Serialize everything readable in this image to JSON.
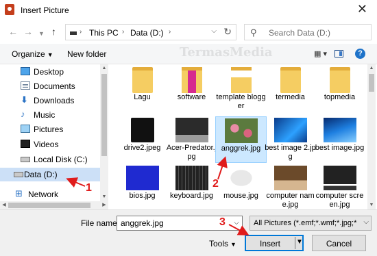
{
  "window": {
    "title": "Insert Picture"
  },
  "address": {
    "crumbs": [
      "This PC",
      "Data (D:)"
    ]
  },
  "search": {
    "placeholder": "Search Data (D:)"
  },
  "toolbar": {
    "organize": "Organize",
    "new_folder": "New folder"
  },
  "watermark": "TermasMedia",
  "nav": {
    "items": [
      {
        "label": "Desktop",
        "icon": "desktop-icon"
      },
      {
        "label": "Documents",
        "icon": "documents-icon"
      },
      {
        "label": "Downloads",
        "icon": "downloads-icon"
      },
      {
        "label": "Music",
        "icon": "music-icon"
      },
      {
        "label": "Pictures",
        "icon": "pictures-icon"
      },
      {
        "label": "Videos",
        "icon": "videos-icon"
      },
      {
        "label": "Local Disk (C:)",
        "icon": "disk-icon"
      },
      {
        "label": "Data (D:)",
        "icon": "disk-icon",
        "selected": true
      },
      {
        "label": "Network",
        "icon": "network-icon"
      }
    ]
  },
  "files": [
    {
      "label": "Lagu",
      "kind": "folder"
    },
    {
      "label": "software",
      "kind": "folder-pink"
    },
    {
      "label": "template blogger",
      "kind": "folder-paper"
    },
    {
      "label": "termedia",
      "kind": "folder"
    },
    {
      "label": "topmedia",
      "kind": "folder"
    },
    {
      "label": "drive2.jpeg",
      "kind": "floppy"
    },
    {
      "label": "Acer-Predator.jpg",
      "kind": "laptop"
    },
    {
      "label": "anggrek.jpg",
      "kind": "flower",
      "selected": true
    },
    {
      "label": "best image 2.jpg",
      "kind": "blue"
    },
    {
      "label": "best image.jpg",
      "kind": "blue2"
    },
    {
      "label": "bios.jpg",
      "kind": "bios"
    },
    {
      "label": "keyboard.jpg",
      "kind": "keyboard"
    },
    {
      "label": "mouse.jpg",
      "kind": "mouse"
    },
    {
      "label": "computer name.jpg",
      "kind": "comp"
    },
    {
      "label": "computer screen.jpg",
      "kind": "screen"
    }
  ],
  "footer": {
    "file_name_label": "File name:",
    "file_name_value": "anggrek.jpg",
    "file_type": "All Pictures (*.emf;*.wmf;*.jpg;*",
    "tools": "Tools",
    "insert": "Insert",
    "cancel": "Cancel"
  },
  "annotations": [
    "1",
    "2",
    "3"
  ],
  "colors": {
    "accent": "#0078d7",
    "selection": "#cce8ff",
    "annotation": "#e01b1b"
  }
}
